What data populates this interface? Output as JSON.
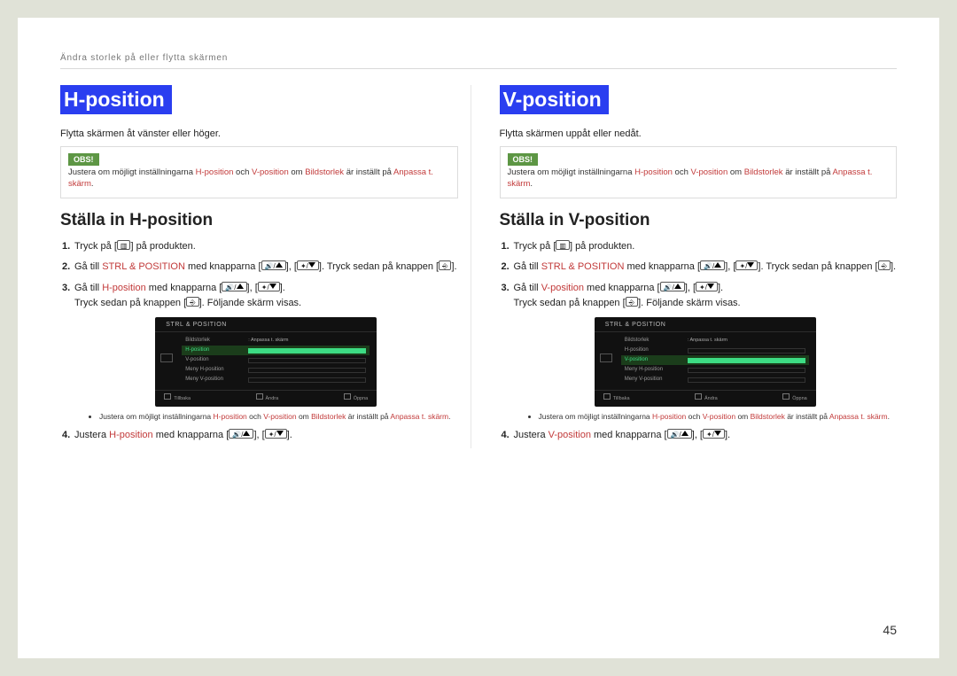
{
  "breadcrumb": "Ändra storlek på eller flytta skärmen",
  "page_number": "45",
  "sections": [
    {
      "heading": "H-position",
      "intro": "Flytta skärmen åt vänster eller höger.",
      "obs_label": "OBS!",
      "obs_text_pre": "Justera om möjligt inställningarna ",
      "obs_hpos": "H-position",
      "obs_and": " och ",
      "obs_vpos": "V-position",
      "obs_mid": " om ",
      "obs_bild": "Bildstorlek",
      "obs_set": " är inställt på ",
      "obs_anp": "Anpassa t. skärm",
      "subhead": "Ställa in H-position",
      "step1_pre": "Tryck på [",
      "step1_post": "] på produkten.",
      "step2_pre": "Gå till ",
      "step2_link": "STRL & POSITION",
      "step2_mid": " med knapparna [",
      "step2_sep": "], [",
      "step2_post": "]. Tryck sedan på knappen [",
      "step2_end": "].",
      "step3_pre": "Gå till ",
      "step3_link": "H-position",
      "step3_mid": " med knapparna [",
      "step3_sep": "], [",
      "step3_end": "].",
      "step3_line2_pre": "Tryck sedan på knappen [",
      "step3_line2_post": "]. Följande skärm visas.",
      "osd_title": "STRL & POSITION",
      "osd_rows": [
        {
          "label": "Bildstorlek",
          "val": "Anpassa t. skärm"
        },
        {
          "label": "H-position",
          "sel": true
        },
        {
          "label": "V-position",
          "bar": true
        },
        {
          "label": "Meny H-position",
          "bar": true
        },
        {
          "label": "Meny V-position",
          "bar": true
        }
      ],
      "osd_foot": [
        "Tillbaka",
        "Ändra",
        "Öppna"
      ],
      "bullet_pre": "Justera om möjligt inställningarna ",
      "bullet_hpos": "H-position",
      "bullet_and": " och ",
      "bullet_vpos": "V-position",
      "bullet_mid": " om ",
      "bullet_bild": "Bildstorlek",
      "bullet_set": " är inställt på ",
      "bullet_anp": "Anpassa t. skärm",
      "step4_pre": "Justera ",
      "step4_link": "H-position",
      "step4_mid": " med knapparna [",
      "step4_sep": "], [",
      "step4_end": "]."
    },
    {
      "heading": "V-position",
      "intro": "Flytta skärmen uppåt eller nedåt.",
      "obs_label": "OBS!",
      "obs_text_pre": "Justera om möjligt inställningarna ",
      "obs_hpos": "H-position",
      "obs_and": " och ",
      "obs_vpos": "V-position",
      "obs_mid": " om ",
      "obs_bild": "Bildstorlek",
      "obs_set": " är inställt på ",
      "obs_anp": "Anpassa t. skärm",
      "subhead": "Ställa in V-position",
      "step1_pre": "Tryck på [",
      "step1_post": "] på produkten.",
      "step2_pre": "Gå till ",
      "step2_link": "STRL & POSITION",
      "step2_mid": " med knapparna [",
      "step2_sep": "], [",
      "step2_post": "]. Tryck sedan på knappen [",
      "step2_end": "].",
      "step3_pre": "Gå till ",
      "step3_link": "V-position",
      "step3_mid": " med knapparna [",
      "step3_sep": "], [",
      "step3_end": "].",
      "step3_line2_pre": "Tryck sedan på knappen [",
      "step3_line2_post": "]. Följande skärm visas.",
      "osd_title": "STRL & POSITION",
      "osd_rows": [
        {
          "label": "Bildstorlek",
          "val": "Anpassa t. skärm"
        },
        {
          "label": "H-position",
          "bar": true
        },
        {
          "label": "V-position",
          "sel": true
        },
        {
          "label": "Meny H-position",
          "bar": true
        },
        {
          "label": "Meny V-position",
          "bar": true
        }
      ],
      "osd_foot": [
        "Tillbaka",
        "Ändra",
        "Öppna"
      ],
      "bullet_pre": "Justera om möjligt inställningarna ",
      "bullet_hpos": "H-position",
      "bullet_and": " och ",
      "bullet_vpos": "V-position",
      "bullet_mid": " om ",
      "bullet_bild": "Bildstorlek",
      "bullet_set": " är inställt på ",
      "bullet_anp": "Anpassa t. skärm",
      "step4_pre": "Justera ",
      "step4_link": "V-position",
      "step4_mid": " med knapparna [",
      "step4_sep": "], [",
      "step4_end": "]."
    }
  ]
}
